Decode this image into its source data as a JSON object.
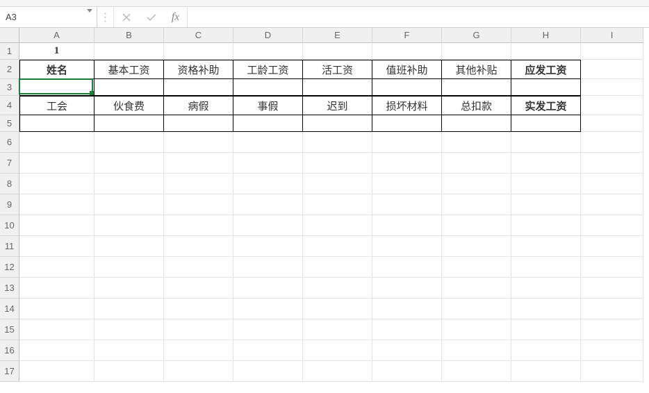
{
  "name_box": {
    "value": "A3"
  },
  "formula_bar": {
    "fx_label": "fx",
    "value": "",
    "cancel_enabled": false,
    "confirm_enabled": false
  },
  "columns": [
    {
      "letter": "A",
      "width": 108
    },
    {
      "letter": "B",
      "width": 100
    },
    {
      "letter": "C",
      "width": 100
    },
    {
      "letter": "D",
      "width": 100
    },
    {
      "letter": "E",
      "width": 100
    },
    {
      "letter": "F",
      "width": 100
    },
    {
      "letter": "G",
      "width": 100
    },
    {
      "letter": "H",
      "width": 100
    },
    {
      "letter": "I",
      "width": 90
    }
  ],
  "rows": [
    {
      "n": 1,
      "height": 24
    },
    {
      "n": 2,
      "height": 28
    },
    {
      "n": 3,
      "height": 24
    },
    {
      "n": 4,
      "height": 28
    },
    {
      "n": 5,
      "height": 24
    },
    {
      "n": 6,
      "height": 30
    },
    {
      "n": 7,
      "height": 30
    },
    {
      "n": 8,
      "height": 30
    },
    {
      "n": 9,
      "height": 30
    },
    {
      "n": 10,
      "height": 30
    },
    {
      "n": 11,
      "height": 30
    },
    {
      "n": 12,
      "height": 30
    },
    {
      "n": 13,
      "height": 30
    },
    {
      "n": 14,
      "height": 30
    },
    {
      "n": 15,
      "height": 30
    },
    {
      "n": 16,
      "height": 30
    },
    {
      "n": 17,
      "height": 30
    }
  ],
  "active_cell": {
    "col": "A",
    "row": 3
  },
  "sheet": {
    "row1": {
      "A": "1"
    },
    "row2": {
      "A": "姓名",
      "B": "基本工资",
      "C": "资格补助",
      "D": "工龄工资",
      "E": "活工资",
      "F": "值班补助",
      "G": "其他补贴",
      "H": "应发工资"
    },
    "row4": {
      "A": "工会",
      "B": "伙食费",
      "C": "病假",
      "D": "事假",
      "E": "迟到",
      "F": "损坏材料",
      "G": "总扣款",
      "H": "实发工资"
    }
  }
}
